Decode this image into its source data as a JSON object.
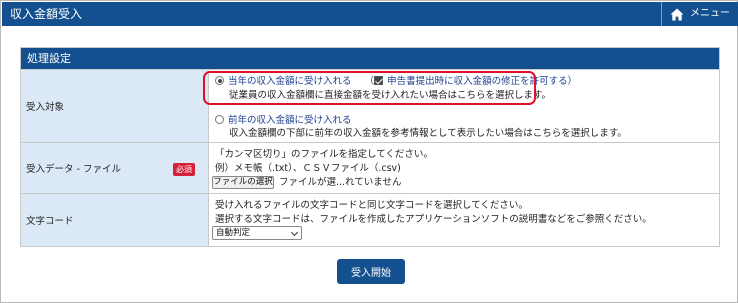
{
  "header": {
    "title": "収入金額受入",
    "menu_label": "メニュー",
    "menu_icon": "home-icon"
  },
  "panel": {
    "title": "処理設定",
    "rows": {
      "target": {
        "label": "受入対象",
        "option_current": {
          "label": "当年の収入金額に受け入れる",
          "checkbox_label": "申告書提出時に収入金額の修正を許可する",
          "checkbox_checked": true,
          "description": "従業員の収入金額欄に直接金額を受け入れたい場合はこちらを選択します。",
          "selected": true
        },
        "option_previous": {
          "label": "前年の収入金額に受け入れる",
          "description": "収入金額欄の下部に前年の収入金額を参考情報として表示したい場合はこちらを選択します。",
          "selected": false
        }
      },
      "file": {
        "label": "受入データ - ファイル",
        "required_badge": "必須",
        "instruction": "「カンマ区切り」のファイルを指定してください。",
        "example": "例）メモ帳（.txt）、ＣＳＶファイル（.csv)",
        "choose_button": "ファイルの選択",
        "status": "ファイルが選...れていません"
      },
      "encoding": {
        "label": "文字コード",
        "instruction1": "受け入れるファイルの文字コードと同じ文字コードを選択してください。",
        "instruction2": "選択する文字コードは、ファイルを作成したアプリケーションソフトの説明書などをご参照ください。",
        "selected_value": "自動判定"
      }
    }
  },
  "actions": {
    "submit_label": "受入開始"
  },
  "colors": {
    "brand": "#14508f",
    "label_bg": "#dbe8f5",
    "highlight": "#e0102a",
    "badge": "#d6213a"
  }
}
